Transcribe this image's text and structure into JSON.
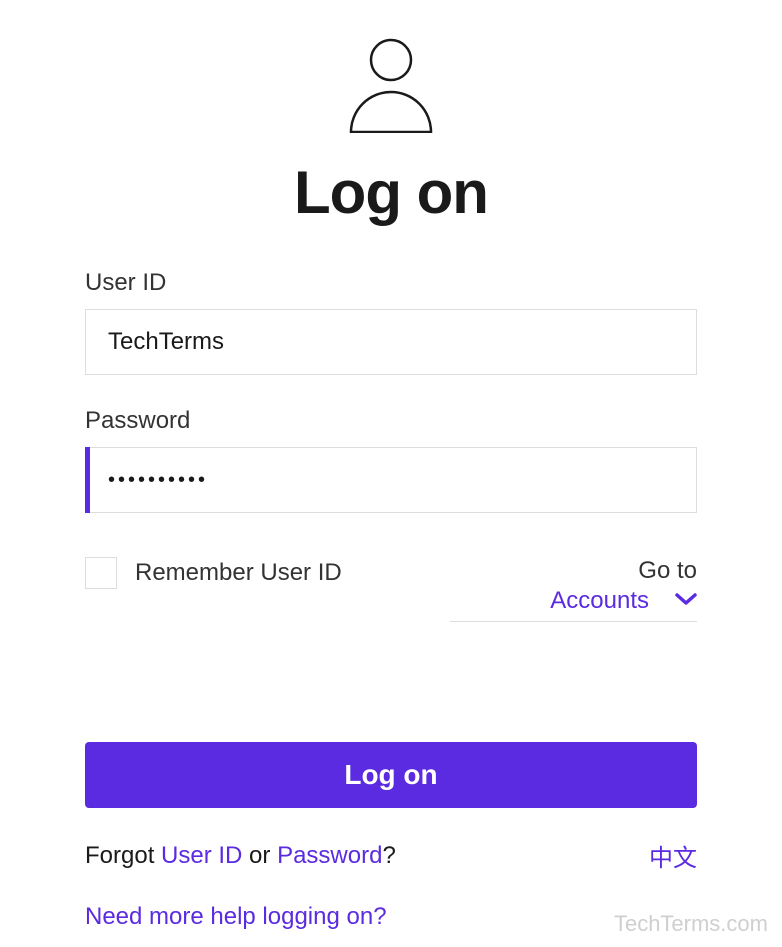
{
  "title": "Log on",
  "fields": {
    "userId": {
      "label": "User ID",
      "value": "TechTerms"
    },
    "password": {
      "label": "Password",
      "value": "••••••••••"
    }
  },
  "remember": {
    "label": "Remember User ID",
    "checked": false
  },
  "goto": {
    "label": "Go to",
    "value": "Accounts"
  },
  "submit": {
    "label": "Log on"
  },
  "forgot": {
    "prefix": "Forgot ",
    "userIdLink": "User ID",
    "middle": " or ",
    "passwordLink": "Password",
    "suffix": "?"
  },
  "language": {
    "label": "中文"
  },
  "help": {
    "label": "Need more help logging on?"
  },
  "watermark": "TechTerms.com",
  "colors": {
    "accent": "#5a2be0"
  }
}
